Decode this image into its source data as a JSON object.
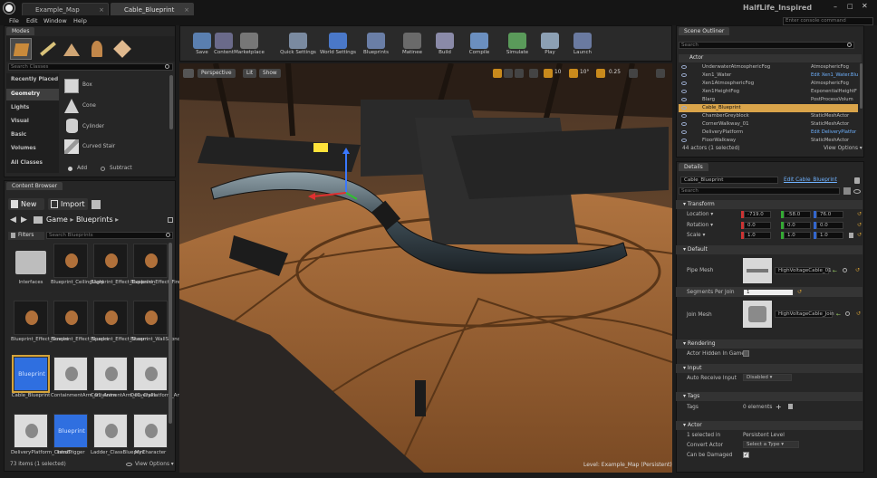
{
  "window": {
    "title": "HalfLife_Inspired",
    "tabs": [
      {
        "label": "Example_Map",
        "active": false
      },
      {
        "label": "Cable_Blueprint",
        "active": true
      }
    ],
    "console_placeholder": "Enter console command",
    "controls": [
      "–",
      "□",
      "✕"
    ]
  },
  "menu": [
    "File",
    "Edit",
    "Window",
    "Help"
  ],
  "modes": {
    "tab": "Modes",
    "search_placeholder": "Search Classes",
    "categories": [
      "Recently Placed",
      "Geometry",
      "Lights",
      "Visual",
      "Basic",
      "Volumes",
      "All Classes"
    ],
    "selected_category": "Geometry",
    "items": [
      "Box",
      "Cone",
      "Cylinder",
      "Curved Stair"
    ],
    "add_label": "Add",
    "subtract_label": "Subtract"
  },
  "toolbar": [
    "Save",
    "Content",
    "Marketplace",
    "Quick Settings",
    "World Settings",
    "Blueprints",
    "Matinee",
    "Build",
    "Compile",
    "Simulate",
    "Play",
    "Launch"
  ],
  "viewport": {
    "perspective": "Perspective",
    "lit": "Lit",
    "show": "Show",
    "right_values": [
      "10",
      "10°",
      "0.25"
    ],
    "level_label": "Level:",
    "level_name": "Example_Map (Persistent)"
  },
  "content_browser": {
    "tab": "Content Browser",
    "new_label": "New",
    "import_label": "Import",
    "path": [
      "Game",
      "Blueprints"
    ],
    "filters_label": "Filters",
    "search_placeholder": "Search Blueprints",
    "items": [
      "Interfaces",
      "Blueprint_CeilingLight",
      "Blueprint_Effect_Explosion",
      "Blueprint_Effect_Fire",
      "Blueprint_Effect_Smoke",
      "Blueprint_Effect_Sparks",
      "Blueprint_Effect_Steam",
      "Blueprint_WallSconce",
      "Cable_Blueprint",
      "ContainmentArm_01_Anim",
      "ContainmentArm_01_Class",
      "DeliveryPlatform_Animat",
      "DeliveryPlatform_ClassBl",
      "IntroTrigger",
      "Ladder_ClassBlueprint",
      "MyCharacter"
    ],
    "thumb_blueprint_text": "Blueprint",
    "status": "73 items (1 selected)",
    "view_options": "View Options"
  },
  "outliner": {
    "tab": "Scene Outliner",
    "search_placeholder": "Search",
    "col_actor": "Actor",
    "rows": [
      {
        "name": "UnderwaterAtmosphericFog",
        "type": "AtmosphericFog",
        "sel": false
      },
      {
        "name": "Xen1_Water",
        "type": "Edit Xen1_Water.Blu",
        "sel": false
      },
      {
        "name": "Xen1AtmosphericFog",
        "type": "AtmosphericFog",
        "sel": false
      },
      {
        "name": "Xen1HeightFog",
        "type": "ExponentialHeightF",
        "sel": false
      },
      {
        "name": "Blarg",
        "type": "PostProcessVolum",
        "sel": false
      },
      {
        "name": "Cable_Blueprint",
        "type": "",
        "sel": true
      },
      {
        "name": "ChamberGreyblock",
        "type": "StaticMeshActor",
        "sel": false
      },
      {
        "name": "CornerWalkway_01",
        "type": "StaticMeshActor",
        "sel": false
      },
      {
        "name": "DeliveryPlatform",
        "type": "Edit DeliveryPlatfor",
        "sel": false
      },
      {
        "name": "FloorWalkway",
        "type": "StaticMeshActor",
        "sel": false
      }
    ],
    "status": "44 actors (1 selected)",
    "view_options": "View Options"
  },
  "details": {
    "tab": "Details",
    "name_value": "Cable_Blueprint",
    "edit_link": "Edit Cable_Blueprint",
    "search_placeholder": "Search",
    "transform_header": "Transform",
    "location_label": "Location",
    "rotation_label": "Rotation",
    "scale_label": "Scale",
    "location": [
      "-719.0",
      "-58.0",
      "76.0"
    ],
    "rotation": [
      "0.0",
      "0.0",
      "0.0"
    ],
    "scale": [
      "1.0",
      "1.0",
      "1.0"
    ],
    "default_header": "Default",
    "pipe_mesh_label": "Pipe Mesh",
    "pipe_mesh_value": "HighVoltageCable_01",
    "segments_label": "Segments Per Join",
    "segments_value": "1",
    "join_mesh_label": "Join Mesh",
    "join_mesh_value": "HighVoltageCable_Join",
    "rendering_header": "Rendering",
    "actor_hidden_label": "Actor Hidden In Game",
    "input_header": "Input",
    "auto_receive_label": "Auto Receive Input",
    "auto_receive_value": "Disabled",
    "tags_header": "Tags",
    "tags_label": "Tags",
    "tags_value": "0 elements",
    "actor_header": "Actor",
    "selected_in_label": "1 selected in",
    "selected_in_value": "Persistent Level",
    "convert_label": "Convert Actor",
    "convert_value": "Select a Type",
    "can_be_damaged_label": "Can be Damaged"
  }
}
